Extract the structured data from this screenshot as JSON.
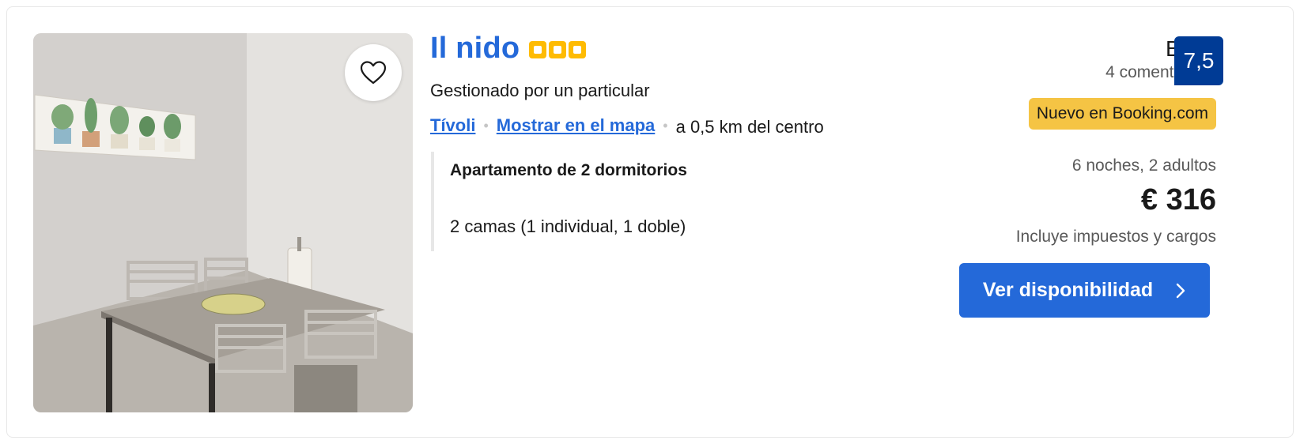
{
  "listing": {
    "name": "Il nido",
    "stars": 3,
    "star_color": "#febb02",
    "managed_by": "Gestionado por un particular",
    "district_link": "Tívoli",
    "map_link": "Mostrar en el mapa",
    "distance": "a 0,5 km del centro",
    "favorite_icon": "heart-icon",
    "unit": {
      "name": "Apartamento de 2 dormitorios",
      "beds": "2 camas (1 individual, 1 doble)"
    }
  },
  "review": {
    "word": "Bien",
    "count": "4 comentarios",
    "score": "7,5",
    "score_color": "#003b95"
  },
  "badge": {
    "label": "Nuevo en Booking.com",
    "color": "#f5c444"
  },
  "pricing": {
    "stay": "6 noches, 2 adultos",
    "price": "€ 316",
    "taxes_note": "Incluye impuestos y cargos"
  },
  "cta": {
    "label": "Ver disponibilidad",
    "icon": "chevron-right-icon",
    "color": "#2469d9"
  }
}
